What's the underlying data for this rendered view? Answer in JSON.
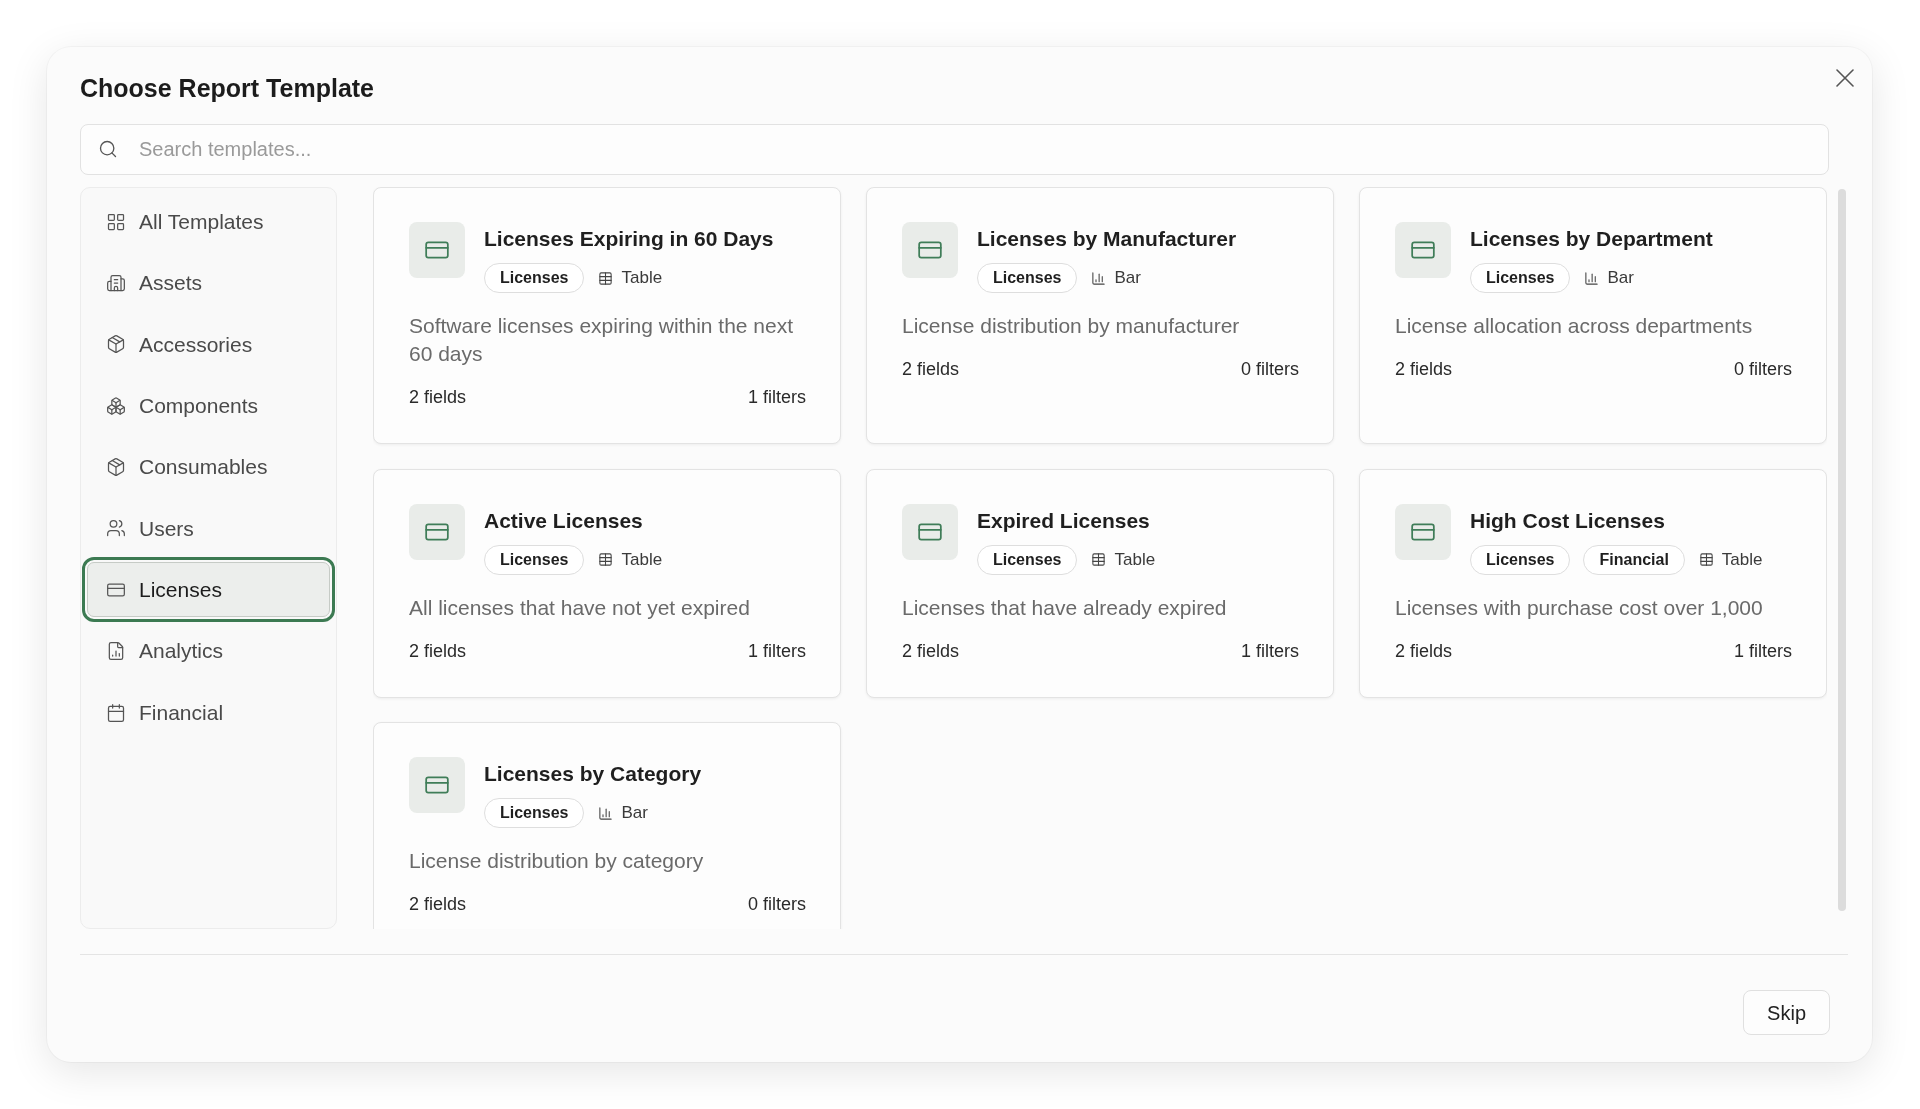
{
  "dialog": {
    "title": "Choose Report Template"
  },
  "search": {
    "placeholder": "Search templates..."
  },
  "sidebar": {
    "items": [
      {
        "label": "All Templates",
        "selected": false
      },
      {
        "label": "Assets",
        "selected": false
      },
      {
        "label": "Accessories",
        "selected": false
      },
      {
        "label": "Components",
        "selected": false
      },
      {
        "label": "Consumables",
        "selected": false
      },
      {
        "label": "Users",
        "selected": false
      },
      {
        "label": "Licenses",
        "selected": true
      },
      {
        "label": "Analytics",
        "selected": false
      },
      {
        "label": "Financial",
        "selected": false
      }
    ]
  },
  "templates": [
    {
      "title": "Licenses Expiring in 60 Days",
      "tags": [
        "Licenses"
      ],
      "chart": {
        "kind": "table",
        "label": "Table"
      },
      "description": "Software licenses expiring within the next 60 days",
      "fields": "2 fields",
      "filters": "1 filters"
    },
    {
      "title": "Licenses by Manufacturer",
      "tags": [
        "Licenses"
      ],
      "chart": {
        "kind": "bar",
        "label": "Bar"
      },
      "description": "License distribution by manufacturer",
      "fields": "2 fields",
      "filters": "0 filters"
    },
    {
      "title": "Licenses by Department",
      "tags": [
        "Licenses"
      ],
      "chart": {
        "kind": "bar",
        "label": "Bar"
      },
      "description": "License allocation across departments",
      "fields": "2 fields",
      "filters": "0 filters"
    },
    {
      "title": "Active Licenses",
      "tags": [
        "Licenses"
      ],
      "chart": {
        "kind": "table",
        "label": "Table"
      },
      "description": "All licenses that have not yet expired",
      "fields": "2 fields",
      "filters": "1 filters"
    },
    {
      "title": "Expired Licenses",
      "tags": [
        "Licenses"
      ],
      "chart": {
        "kind": "table",
        "label": "Table"
      },
      "description": "Licenses that have already expired",
      "fields": "2 fields",
      "filters": "1 filters"
    },
    {
      "title": "High Cost Licenses",
      "tags": [
        "Licenses",
        "Financial"
      ],
      "chart": {
        "kind": "table",
        "label": "Table"
      },
      "description": "Licenses with purchase cost over 1,000",
      "fields": "2 fields",
      "filters": "1 filters"
    },
    {
      "title": "Licenses by Category",
      "tags": [
        "Licenses"
      ],
      "chart": {
        "kind": "bar",
        "label": "Bar"
      },
      "description": "License distribution by category",
      "fields": "2 fields",
      "filters": "0 filters"
    }
  ],
  "footer": {
    "buttons": [
      {
        "label": "Skip"
      }
    ]
  }
}
